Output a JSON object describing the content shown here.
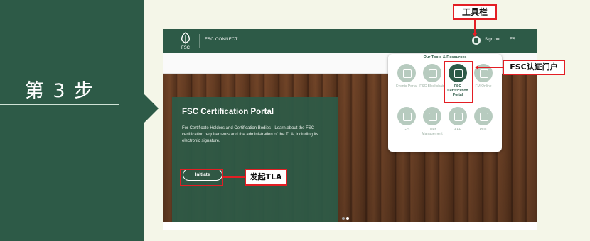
{
  "step": {
    "title": "第 3 步"
  },
  "header": {
    "logo_text": "FSC",
    "brand": "FSC CONNECT",
    "sign_out": "Sign out",
    "language": "ES"
  },
  "hero": {
    "title": "FSC Certification Portal",
    "description": "For Certificate Holders and Certification Bodies - Learn about the FSC certification requirements and the administration of the TLA, including its electronic signature.",
    "button": "Initiate"
  },
  "dropdown": {
    "title": "Our Tools & Resources",
    "tools": [
      {
        "label": "Events Portal",
        "icon": "calendar-icon"
      },
      {
        "label": "FSC Blockchain",
        "icon": "blockchain-icon"
      },
      {
        "label": "FSC Certification Portal",
        "icon": "document-icon",
        "active": true
      },
      {
        "label": "FM Online",
        "icon": "monitor-icon"
      },
      {
        "label": "GIS",
        "icon": "map-icon"
      },
      {
        "label": "User Management",
        "icon": "users-icon"
      },
      {
        "label": "AAF",
        "icon": "form-icon"
      },
      {
        "label": "PDC",
        "icon": "database-icon"
      }
    ]
  },
  "annotations": {
    "toolbar": "工具栏",
    "portal": "FSC认证门户",
    "initiate": "发起TLA"
  },
  "colors": {
    "brand_green": "#2d5a47",
    "highlight_red": "#e31e24"
  }
}
